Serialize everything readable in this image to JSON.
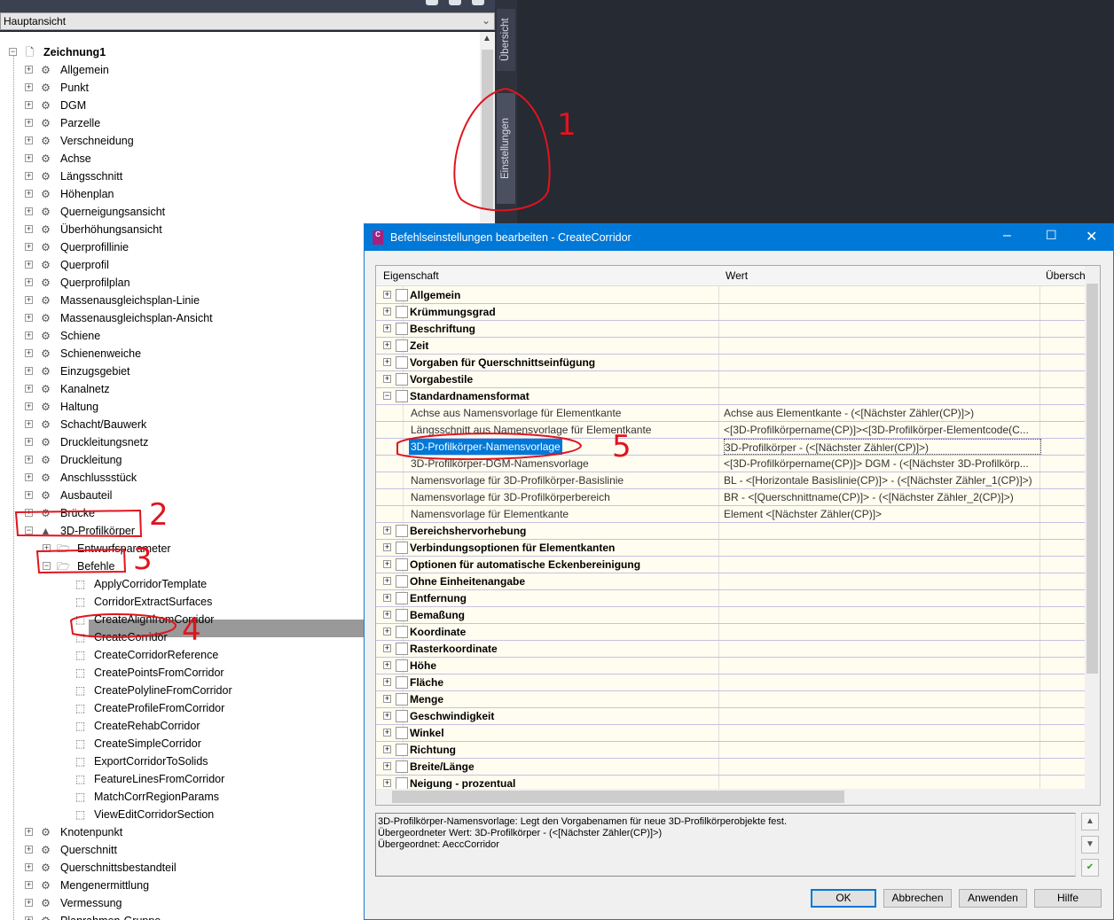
{
  "toolspace": {
    "view_selector": "Hauptansicht",
    "root": "Zeichnung1",
    "items": [
      "Allgemein",
      "Punkt",
      "DGM",
      "Parzelle",
      "Verschneidung",
      "Achse",
      "Längsschnitt",
      "Höhenplan",
      "Querneigungsansicht",
      "Überhöhungsansicht",
      "Querprofillinie",
      "Querprofil",
      "Querprofilplan",
      "Massenausgleichsplan-Linie",
      "Massenausgleichsplan-Ansicht",
      "Schiene",
      "Schienenweiche",
      "Einzugsgebiet",
      "Kanalnetz",
      "Haltung",
      "Schacht/Bauwerk",
      "Druckleitungsnetz",
      "Druckleitung",
      "Anschlussstück",
      "Ausbauteil",
      "Brücke",
      "3D-Profilkörper"
    ],
    "corridor_children": [
      "Entwurfsparameter",
      "Befehle"
    ],
    "commands": [
      "ApplyCorridorTemplate",
      "CorridorExtractSurfaces",
      "CreateAlignfromCorridor",
      "CreateCorridor",
      "CreateCorridorReference",
      "CreatePointsFromCorridor",
      "CreatePolylineFromCorridor",
      "CreateProfileFromCorridor",
      "CreateRehabCorridor",
      "CreateSimpleCorridor",
      "ExportCorridorToSolids",
      "FeatureLinesFromCorridor",
      "MatchCorrRegionParams",
      "ViewEditCorridorSection"
    ],
    "selected_command": "CreateCorridor",
    "items_after": [
      "Knotenpunkt",
      "Querschnitt",
      "Querschnittsbestandteil",
      "Mengenermittlung",
      "Vermessung",
      "Planrahmen-Gruppe"
    ],
    "side_tabs": [
      "Übersicht",
      "Einstellungen"
    ]
  },
  "dialog": {
    "title": "Befehlseinstellungen bearbeiten - CreateCorridor",
    "app_icon": "C3D",
    "columns": [
      "Eigenschaft",
      "Wert",
      "Überschr"
    ],
    "groups_before": [
      "Allgemein",
      "Krümmungsgrad",
      "Beschriftung",
      "Zeit",
      "Vorgaben für Querschnittseinfügung",
      "Vorgabestile",
      "Standardnamensformat"
    ],
    "expanded_group": "Standardnamensformat",
    "properties": [
      {
        "name": "Achse aus Namensvorlage für Elementkante",
        "value": "Achse aus Elementkante - (<[Nächster Zähler(CP)]>)"
      },
      {
        "name": "Längsschnitt aus Namensvorlage für Elementkante",
        "value": "<[3D-Profilkörpername(CP)]><[3D-Profilkörper-Elementcode(C..."
      },
      {
        "name": "3D-Profilkörper-Namensvorlage",
        "value": "3D-Profilkörper - (<[Nächster Zähler(CP)]>)",
        "selected": true
      },
      {
        "name": "3D-Profilkörper-DGM-Namensvorlage",
        "value": "<[3D-Profilkörpername(CP)]> DGM - (<[Nächster 3D-Profilkörp..."
      },
      {
        "name": "Namensvorlage für 3D-Profilkörper-Basislinie",
        "value": "BL - <[Horizontale Basislinie(CP)]> - (<[Nächster Zähler_1(CP)]>)"
      },
      {
        "name": "Namensvorlage für 3D-Profilkörperbereich",
        "value": "BR - <[Querschnittname(CP)]> - (<[Nächster Zähler_2(CP)]>)"
      },
      {
        "name": "Namensvorlage für Elementkante",
        "value": "Element <[Nächster Zähler(CP)]>"
      }
    ],
    "groups_after": [
      "Bereichshervorhebung",
      "Verbindungsoptionen für Elementkanten",
      "Optionen für automatische Eckenbereinigung",
      "Ohne Einheitenangabe",
      "Entfernung",
      "Bemaßung",
      "Koordinate",
      "Rasterkoordinate",
      "Höhe",
      "Fläche",
      "Menge",
      "Geschwindigkeit",
      "Winkel",
      "Richtung",
      "Breite/Länge",
      "Neigung - prozentual"
    ],
    "description": [
      "3D-Profilkörper-Namensvorlage: Legt den Vorgabenamen für neue 3D-Profilkörperobjekte fest.",
      "Übergeordneter Wert: 3D-Profilkörper - (<[Nächster Zähler(CP)]>)",
      "Übergeordnet: AeccCorridor"
    ],
    "buttons": {
      "ok": "OK",
      "cancel": "Abbrechen",
      "apply": "Anwenden",
      "help": "Hilfe"
    }
  },
  "annotations": [
    "1",
    "2",
    "3",
    "4",
    "5"
  ],
  "colors": {
    "title_bar": "#0078d7",
    "annotation": "#e0141e",
    "selection": "#0078d7"
  }
}
